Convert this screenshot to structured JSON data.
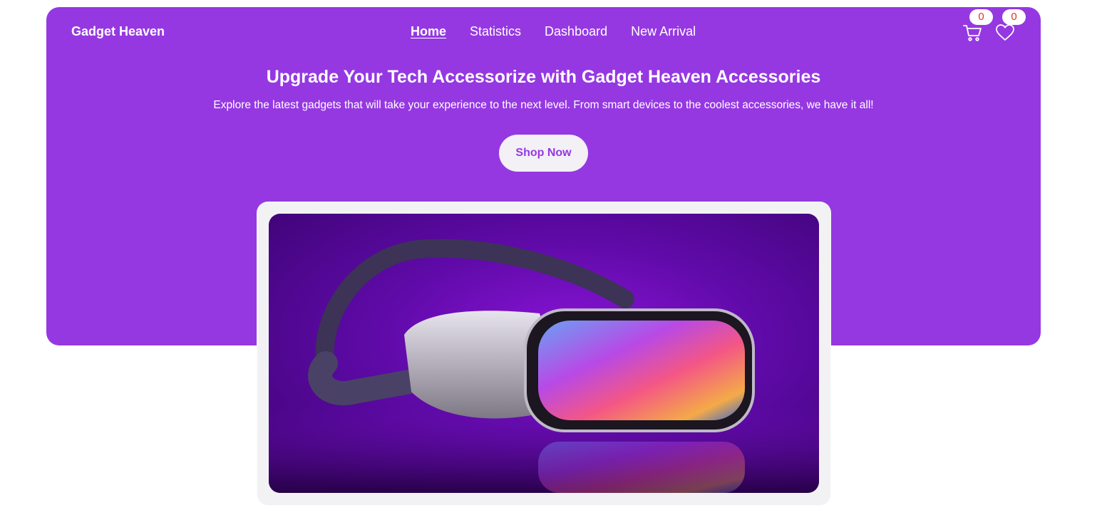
{
  "brand": {
    "name": "Gadget Heaven"
  },
  "nav": {
    "items": [
      {
        "label": "Home",
        "active": true
      },
      {
        "label": "Statistics",
        "active": false
      },
      {
        "label": "Dashboard",
        "active": false
      },
      {
        "label": "New Arrival",
        "active": false
      }
    ]
  },
  "cart": {
    "icon": "cart-icon",
    "count": "0"
  },
  "wishlist": {
    "icon": "heart-icon",
    "count": "0"
  },
  "hero": {
    "title": "Upgrade Your Tech Accessorize with Gadget Heaven Accessories",
    "subtitle": "Explore the latest gadgets that will take your experience to the next level. From smart devices to the coolest accessories, we have it all!",
    "cta_label": "Shop Now",
    "banner_image": "vr-headset-image"
  },
  "colors": {
    "primary": "#9538e2",
    "badge_text": "#e0352b",
    "frame": "#f2f2f4"
  }
}
